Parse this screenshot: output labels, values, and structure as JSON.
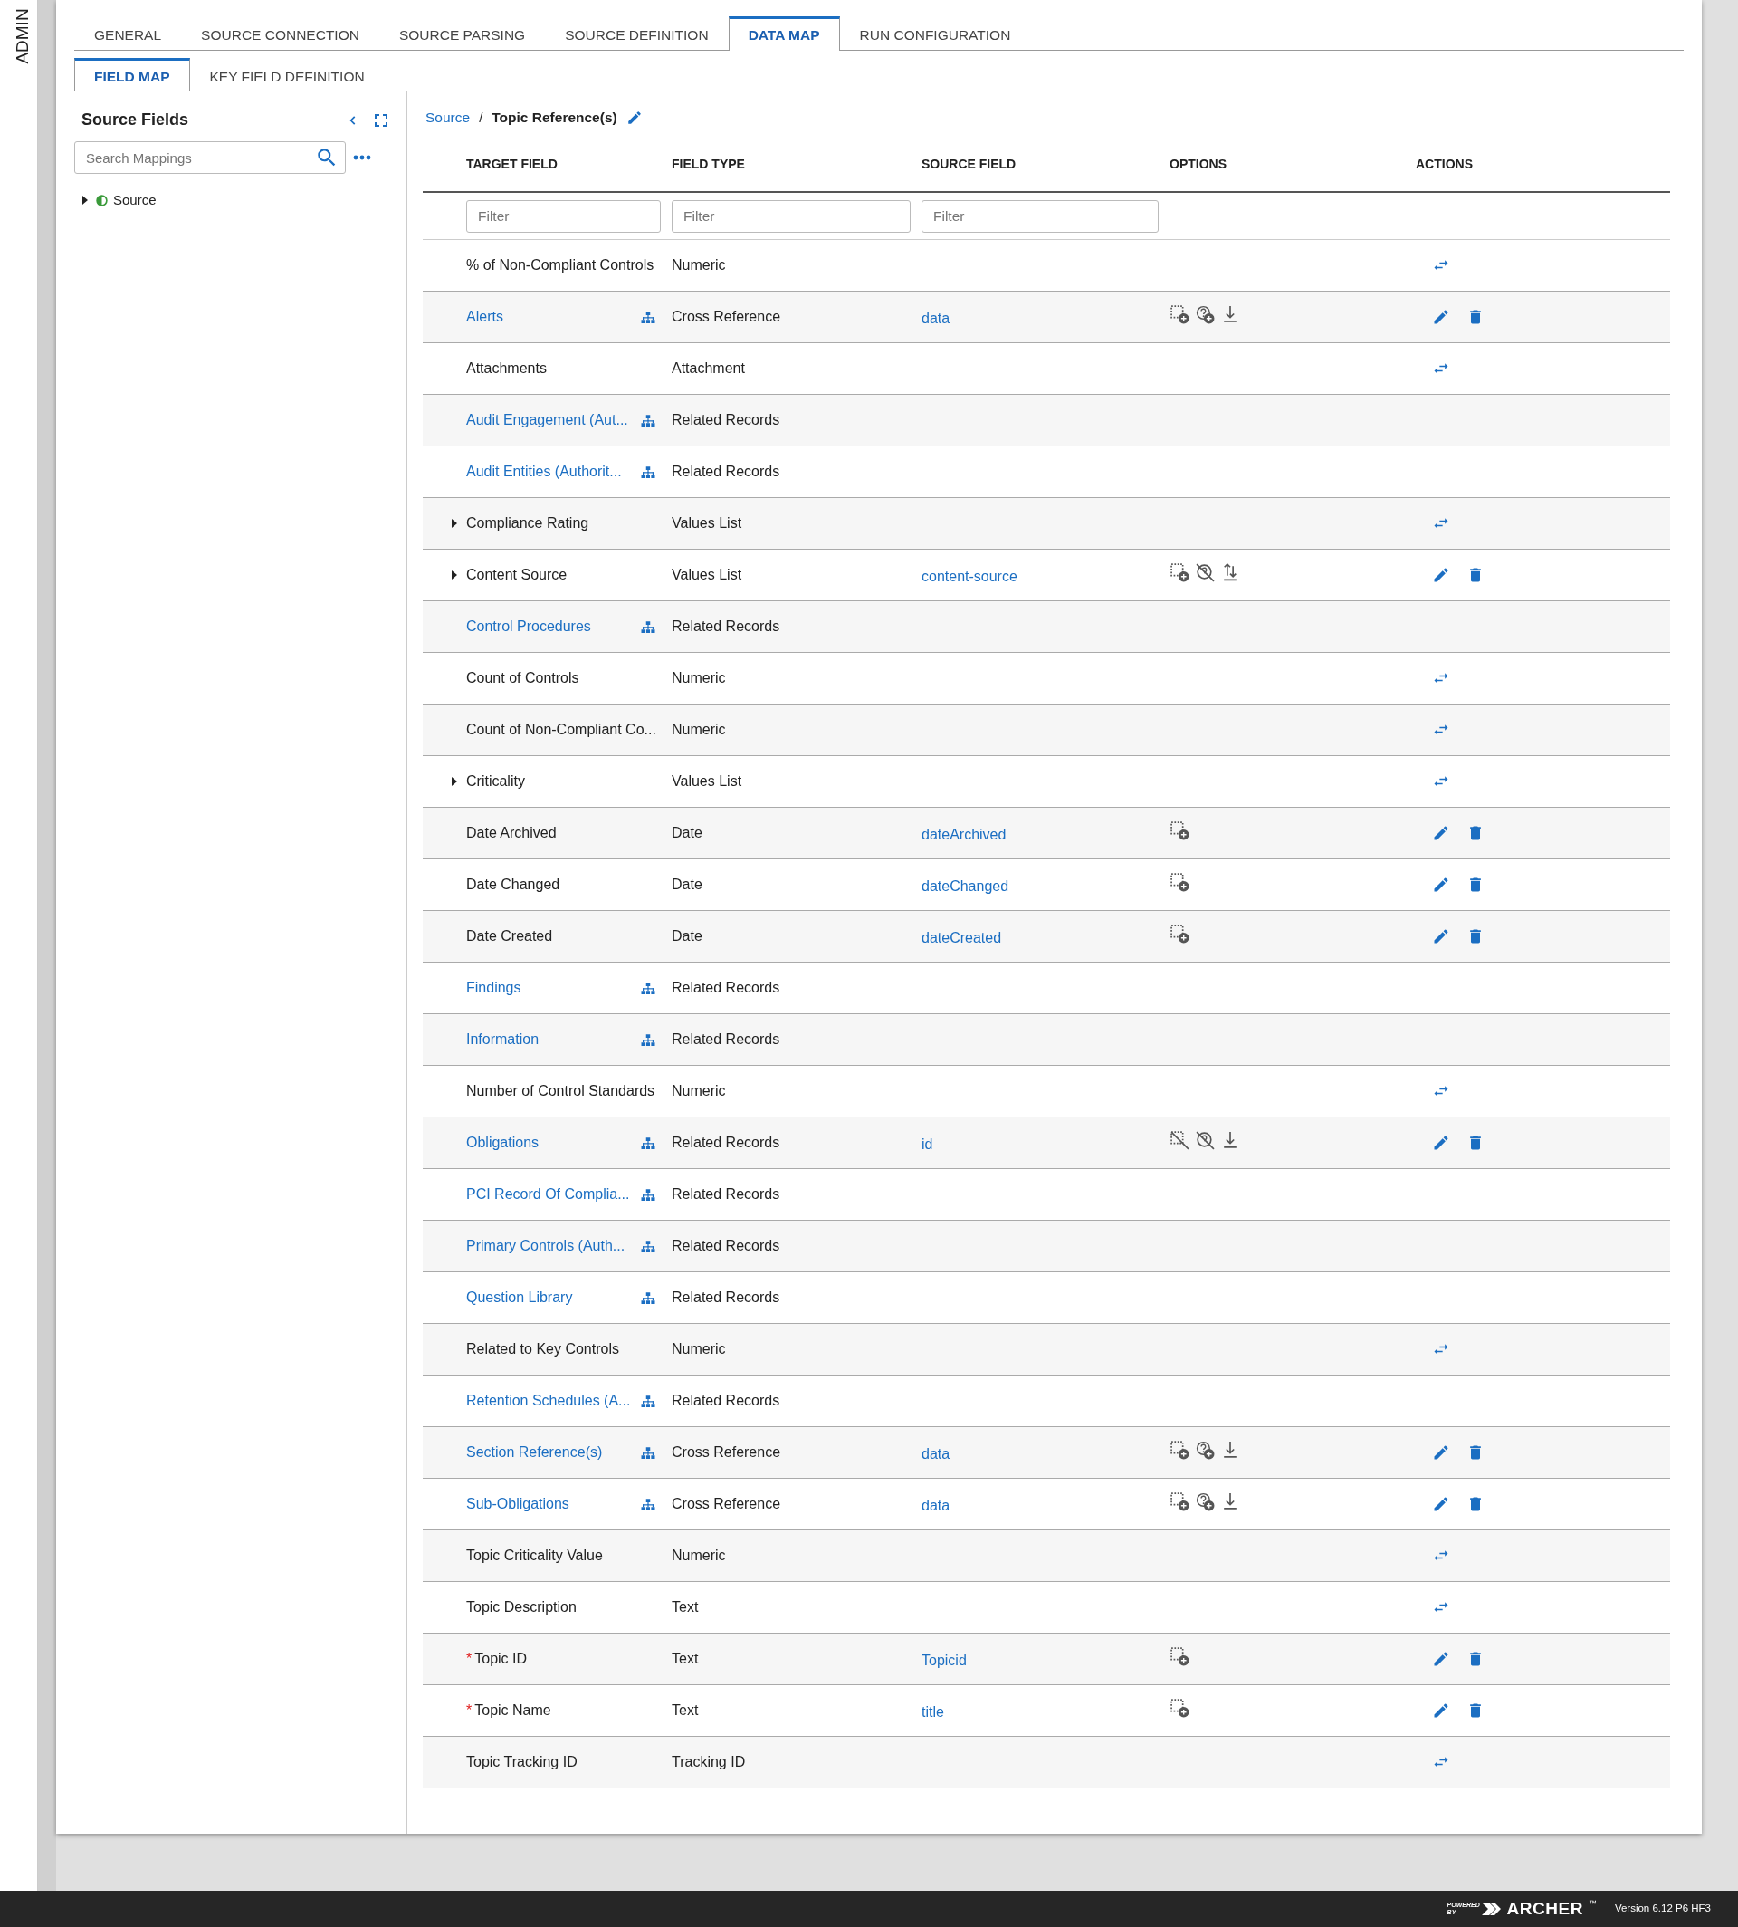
{
  "side_label": "ADMIN",
  "tabs": [
    {
      "label": "GENERAL",
      "selected": false
    },
    {
      "label": "SOURCE CONNECTION",
      "selected": false
    },
    {
      "label": "SOURCE PARSING",
      "selected": false
    },
    {
      "label": "SOURCE DEFINITION",
      "selected": false
    },
    {
      "label": "DATA MAP",
      "selected": true
    },
    {
      "label": "RUN CONFIGURATION",
      "selected": false
    }
  ],
  "subtabs": [
    {
      "label": "FIELD MAP",
      "selected": true
    },
    {
      "label": "KEY FIELD DEFINITION",
      "selected": false
    }
  ],
  "source_panel": {
    "title": "Source Fields",
    "search": {
      "placeholder": "Search Mappings"
    },
    "tree": [
      {
        "label": "Source",
        "expanded": false
      }
    ]
  },
  "breadcrumb": {
    "root": "Source",
    "separator": "/",
    "current": "Topic Reference(s)"
  },
  "table": {
    "columns": [
      "TARGET FIELD",
      "FIELD TYPE",
      "SOURCE FIELD",
      "OPTIONS",
      "ACTIONS"
    ],
    "filters": [
      {
        "placeholder": "Filter"
      },
      {
        "placeholder": "Filter"
      },
      {
        "placeholder": "Filter"
      }
    ],
    "required_marker": "*",
    "rows": [
      {
        "target": "% of Non-Compliant Controls",
        "kind": "field",
        "expandable": false,
        "required": false,
        "type": "Numeric",
        "actions": [
          {
            "kind": "map"
          }
        ]
      },
      {
        "target": "Alerts",
        "kind": "relation",
        "expandable": false,
        "required": false,
        "type": "Cross Reference",
        "source": "data",
        "options": [
          {
            "kind": "box-add"
          },
          {
            "kind": "help-add"
          },
          {
            "kind": "download"
          }
        ],
        "actions": [
          {
            "kind": "edit"
          },
          {
            "kind": "delete"
          }
        ]
      },
      {
        "target": "Attachments",
        "kind": "field",
        "expandable": false,
        "required": false,
        "type": "Attachment",
        "actions": [
          {
            "kind": "map"
          }
        ]
      },
      {
        "target": "Audit Engagement (Aut...",
        "kind": "relation",
        "expandable": false,
        "required": false,
        "type": "Related Records"
      },
      {
        "target": "Audit Entities (Authorit...",
        "kind": "relation",
        "expandable": false,
        "required": false,
        "type": "Related Records"
      },
      {
        "target": "Compliance Rating",
        "kind": "field",
        "expandable": true,
        "required": false,
        "type": "Values List",
        "actions": [
          {
            "kind": "map"
          }
        ]
      },
      {
        "target": "Content Source",
        "kind": "field",
        "expandable": true,
        "required": false,
        "type": "Values List",
        "source": "content-source",
        "options": [
          {
            "kind": "box-add"
          },
          {
            "kind": "help-off"
          },
          {
            "kind": "updown"
          }
        ],
        "actions": [
          {
            "kind": "edit"
          },
          {
            "kind": "delete"
          }
        ]
      },
      {
        "target": "Control Procedures",
        "kind": "relation",
        "expandable": false,
        "required": false,
        "type": "Related Records"
      },
      {
        "target": "Count of Controls",
        "kind": "field",
        "expandable": false,
        "required": false,
        "type": "Numeric",
        "actions": [
          {
            "kind": "map"
          }
        ]
      },
      {
        "target": "Count of Non-Compliant Co...",
        "kind": "field",
        "expandable": false,
        "required": false,
        "type": "Numeric",
        "actions": [
          {
            "kind": "map"
          }
        ]
      },
      {
        "target": "Criticality",
        "kind": "field",
        "expandable": true,
        "required": false,
        "type": "Values List",
        "actions": [
          {
            "kind": "map"
          }
        ]
      },
      {
        "target": "Date Archived",
        "kind": "field",
        "expandable": false,
        "required": false,
        "type": "Date",
        "source": "dateArchived",
        "options": [
          {
            "kind": "box-add"
          }
        ],
        "actions": [
          {
            "kind": "edit"
          },
          {
            "kind": "delete"
          }
        ]
      },
      {
        "target": "Date Changed",
        "kind": "field",
        "expandable": false,
        "required": false,
        "type": "Date",
        "source": "dateChanged",
        "options": [
          {
            "kind": "box-add"
          }
        ],
        "actions": [
          {
            "kind": "edit"
          },
          {
            "kind": "delete"
          }
        ]
      },
      {
        "target": "Date Created",
        "kind": "field",
        "expandable": false,
        "required": false,
        "type": "Date",
        "source": "dateCreated",
        "options": [
          {
            "kind": "box-add"
          }
        ],
        "actions": [
          {
            "kind": "edit"
          },
          {
            "kind": "delete"
          }
        ]
      },
      {
        "target": "Findings",
        "kind": "relation",
        "expandable": false,
        "required": false,
        "type": "Related Records"
      },
      {
        "target": "Information",
        "kind": "relation",
        "expandable": false,
        "required": false,
        "type": "Related Records"
      },
      {
        "target": "Number of Control Standards",
        "kind": "field",
        "expandable": false,
        "required": false,
        "type": "Numeric",
        "actions": [
          {
            "kind": "map"
          }
        ]
      },
      {
        "target": "Obligations",
        "kind": "relation",
        "expandable": false,
        "required": false,
        "type": "Related Records",
        "source": "id",
        "options": [
          {
            "kind": "box-off"
          },
          {
            "kind": "help-off"
          },
          {
            "kind": "download"
          }
        ],
        "actions": [
          {
            "kind": "edit"
          },
          {
            "kind": "delete"
          }
        ]
      },
      {
        "target": "PCI Record Of Complia...",
        "kind": "relation",
        "expandable": false,
        "required": false,
        "type": "Related Records"
      },
      {
        "target": "Primary Controls (Auth...",
        "kind": "relation",
        "expandable": false,
        "required": false,
        "type": "Related Records"
      },
      {
        "target": "Question Library",
        "kind": "relation",
        "expandable": false,
        "required": false,
        "type": "Related Records"
      },
      {
        "target": "Related to Key Controls",
        "kind": "field",
        "expandable": false,
        "required": false,
        "type": "Numeric",
        "actions": [
          {
            "kind": "map"
          }
        ]
      },
      {
        "target": "Retention Schedules (A...",
        "kind": "relation",
        "expandable": false,
        "required": false,
        "type": "Related Records"
      },
      {
        "target": "Section Reference(s)",
        "kind": "relation",
        "expandable": false,
        "required": false,
        "type": "Cross Reference",
        "source": "data",
        "options": [
          {
            "kind": "box-add"
          },
          {
            "kind": "help-add"
          },
          {
            "kind": "download"
          }
        ],
        "actions": [
          {
            "kind": "edit"
          },
          {
            "kind": "delete"
          }
        ]
      },
      {
        "target": "Sub-Obligations",
        "kind": "relation",
        "expandable": false,
        "required": false,
        "type": "Cross Reference",
        "source": "data",
        "options": [
          {
            "kind": "box-add"
          },
          {
            "kind": "help-add"
          },
          {
            "kind": "download"
          }
        ],
        "actions": [
          {
            "kind": "edit"
          },
          {
            "kind": "delete"
          }
        ]
      },
      {
        "target": "Topic Criticality Value",
        "kind": "field",
        "expandable": false,
        "required": false,
        "type": "Numeric",
        "actions": [
          {
            "kind": "map"
          }
        ]
      },
      {
        "target": "Topic Description",
        "kind": "field",
        "expandable": false,
        "required": false,
        "type": "Text",
        "actions": [
          {
            "kind": "map"
          }
        ]
      },
      {
        "target": "Topic ID",
        "kind": "field",
        "expandable": false,
        "required": true,
        "type": "Text",
        "source": "Topicid",
        "options": [
          {
            "kind": "box-add"
          }
        ],
        "actions": [
          {
            "kind": "edit"
          },
          {
            "kind": "delete"
          }
        ]
      },
      {
        "target": "Topic Name",
        "kind": "field",
        "expandable": false,
        "required": true,
        "type": "Text",
        "source": "title",
        "options": [
          {
            "kind": "box-add"
          }
        ],
        "actions": [
          {
            "kind": "edit"
          },
          {
            "kind": "delete"
          }
        ]
      },
      {
        "target": "Topic Tracking ID",
        "kind": "field",
        "expandable": false,
        "required": false,
        "type": "Tracking ID",
        "actions": [
          {
            "kind": "map"
          }
        ]
      }
    ]
  },
  "footer": {
    "powered": "POWERED BY",
    "brand": "ARCHER",
    "trademark": "™",
    "version": "Version 6.12 P6 HF3"
  }
}
